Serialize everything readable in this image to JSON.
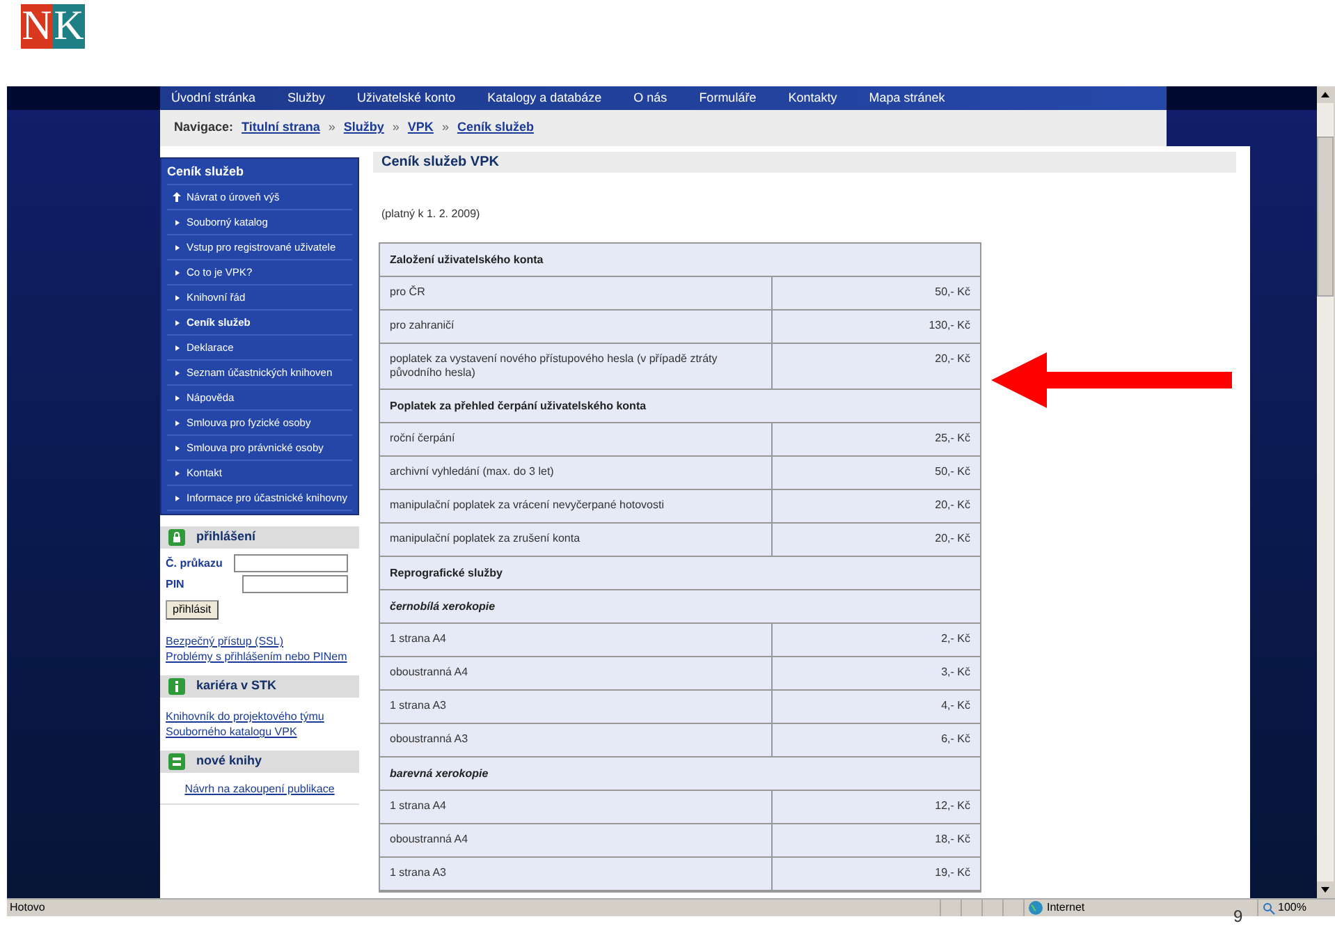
{
  "logo": {
    "letters": [
      "N",
      "K"
    ]
  },
  "browser": {
    "nav_menu": [
      "Úvodní stránka",
      "Služby",
      "Uživatelské konto",
      "Katalogy a databáze",
      "O nás",
      "Formuláře",
      "Kontakty",
      "Mapa stránek"
    ],
    "breadcrumb": {
      "label": "Navigace:",
      "links": [
        "Titulní strana",
        "Služby",
        "VPK",
        "Ceník služeb"
      ],
      "separator": "»"
    },
    "sidebar": {
      "menu_title": "Ceník služeb",
      "menu_items": [
        {
          "label": "Návrat o úroveň výš",
          "kind": "up",
          "selected": false
        },
        {
          "label": "Souborný katalog",
          "kind": "page",
          "selected": false
        },
        {
          "label": "Vstup pro registrované uživatele",
          "kind": "page",
          "selected": false
        },
        {
          "label": "Co to je VPK?",
          "kind": "page",
          "selected": false
        },
        {
          "label": "Knihovní řád",
          "kind": "page",
          "selected": false
        },
        {
          "label": "Ceník služeb",
          "kind": "page",
          "selected": true
        },
        {
          "label": "Deklarace",
          "kind": "page",
          "selected": false
        },
        {
          "label": "Seznam účastnických knihoven",
          "kind": "page",
          "selected": false
        },
        {
          "label": "Nápověda",
          "kind": "page",
          "selected": false
        },
        {
          "label": "Smlouva pro fyzické osoby",
          "kind": "page",
          "selected": false
        },
        {
          "label": "Smlouva pro právnické osoby",
          "kind": "page",
          "selected": false
        },
        {
          "label": "Kontakt",
          "kind": "page",
          "selected": false
        },
        {
          "label": "Informace pro účastnické knihovny",
          "kind": "page",
          "selected": false
        }
      ],
      "login": {
        "title": "přihlášení",
        "fields": [
          {
            "label": "Č. průkazu"
          },
          {
            "label": "PIN"
          }
        ],
        "button": "přihlásit",
        "links": [
          "Bezpečný přístup (SSL)",
          "Problémy s přihlášením nebo PINem"
        ]
      },
      "career": {
        "title": "kariéra v STK",
        "link": "Knihovník do projektového týmu Souborného katalogu VPK"
      },
      "new_books": {
        "title": "nové knihy",
        "link": "Návrh na zakoupení publikace"
      }
    },
    "content": {
      "title": "Ceník služeb VPK",
      "validity": "(platný k 1. 2. 2009)",
      "rows": [
        {
          "kind": "section",
          "label": "Založení uživatelského konta"
        },
        {
          "kind": "item",
          "label": "pro ČR",
          "price": "50,- Kč"
        },
        {
          "kind": "item",
          "label": "pro zahraničí",
          "price": "130,- Kč"
        },
        {
          "kind": "item",
          "label": "poplatek za vystavení nového přístupového hesla (v případě ztráty původního hesla)",
          "price": "20,- Kč"
        },
        {
          "kind": "section",
          "label": "Poplatek za přehled čerpání uživatelského konta"
        },
        {
          "kind": "item",
          "label": "roční čerpání",
          "price": "25,- Kč"
        },
        {
          "kind": "item",
          "label": "archivní vyhledání (max. do 3 let)",
          "price": "50,- Kč"
        },
        {
          "kind": "item",
          "label": "manipulační poplatek za vrácení nevyčerpané hotovosti",
          "price": "20,- Kč"
        },
        {
          "kind": "item",
          "label": "manipulační poplatek za zrušení konta",
          "price": "20,- Kč"
        },
        {
          "kind": "section",
          "label": "Reprografické služby"
        },
        {
          "kind": "subsection",
          "label": "černobílá xerokopie"
        },
        {
          "kind": "item",
          "label": "1 strana A4",
          "price": "2,- Kč"
        },
        {
          "kind": "item",
          "label": "oboustranná A4",
          "price": "3,- Kč"
        },
        {
          "kind": "item",
          "label": "1 strana A3",
          "price": "4,- Kč"
        },
        {
          "kind": "item",
          "label": "oboustranná A3",
          "price": "6,- Kč"
        },
        {
          "kind": "subsection",
          "label": "barevná xerokopie"
        },
        {
          "kind": "item",
          "label": "1 strana A4",
          "price": "12,- Kč"
        },
        {
          "kind": "item",
          "label": "oboustranná A4",
          "price": "18,- Kč"
        },
        {
          "kind": "item",
          "label": "1 strana A3",
          "price": "19,- Kč"
        }
      ]
    },
    "status_bar": {
      "text": "Hotovo",
      "zone": "Internet",
      "zoom": "100%"
    }
  },
  "slide_number": "9"
}
